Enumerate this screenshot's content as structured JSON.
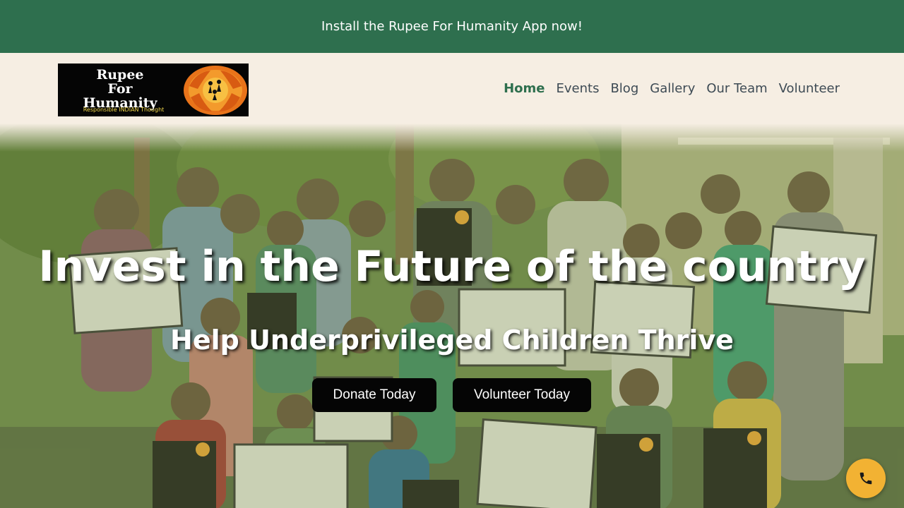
{
  "announcement": {
    "text": "Install the Rupee For Humanity App now!"
  },
  "logo": {
    "line1": "Rupee",
    "line2": "For",
    "line3": "Humanity",
    "tagline": "Responsible INDIAN Thought",
    "emblem_icon": "hands-circle-emblem"
  },
  "nav": {
    "items": [
      {
        "label": "Home",
        "active": true
      },
      {
        "label": "Events"
      },
      {
        "label": "Blog"
      },
      {
        "label": "Gallery"
      },
      {
        "label": "Our Team"
      },
      {
        "label": "Volunteer"
      }
    ]
  },
  "hero": {
    "headline": "Invest in the Future of the country",
    "subheadline": "Help Underprivileged Children Thrive",
    "donate_label": "Donate Today",
    "volunteer_label": "Volunteer Today"
  },
  "call_button": {
    "icon": "phone-icon"
  },
  "colors": {
    "brand_green": "#2e6f4e",
    "header_bg": "#f6eee3",
    "button_bg": "#050505",
    "call_accent": "#f2b233"
  }
}
